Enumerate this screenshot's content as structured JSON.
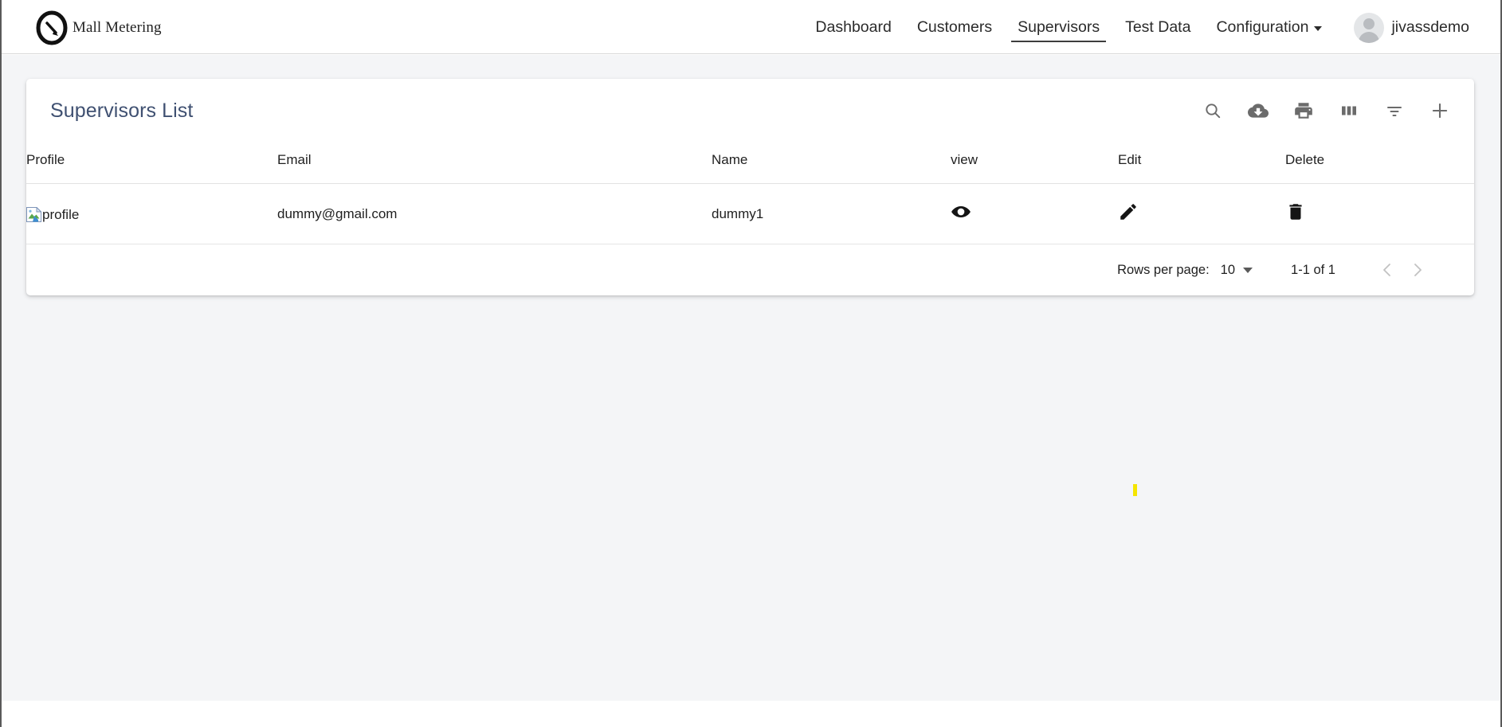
{
  "brand": {
    "name": "Mall Metering",
    "logo_icon": "gauge-meter-icon"
  },
  "nav": {
    "items": [
      {
        "label": "Dashboard",
        "active": false,
        "has_caret": false
      },
      {
        "label": "Customers",
        "active": false,
        "has_caret": false
      },
      {
        "label": "Supervisors",
        "active": true,
        "has_caret": false
      },
      {
        "label": "Test Data",
        "active": false,
        "has_caret": false
      },
      {
        "label": "Configuration",
        "active": false,
        "has_caret": true
      }
    ],
    "user": {
      "name": "jivassdemo",
      "avatar_icon": "user-avatar-icon",
      "caret_icon": "chevron-down-icon"
    }
  },
  "card": {
    "title": "Supervisors List",
    "toolbar": [
      {
        "name": "search-icon",
        "label": "Search"
      },
      {
        "name": "cloud-download-icon",
        "label": "Download"
      },
      {
        "name": "print-icon",
        "label": "Print"
      },
      {
        "name": "view-column-icon",
        "label": "Columns"
      },
      {
        "name": "filter-list-icon",
        "label": "Filter"
      },
      {
        "name": "add-icon",
        "label": "Add"
      }
    ]
  },
  "table": {
    "columns": [
      "Profile",
      "Email",
      "Name",
      "view",
      "Edit",
      "Delete"
    ],
    "rows": [
      {
        "profile_alt": "profile",
        "email": "dummy@gmail.com",
        "name": "dummy1",
        "view_icon": "eye-icon",
        "edit_icon": "pencil-icon",
        "delete_icon": "trash-icon"
      }
    ]
  },
  "paginator": {
    "rows_per_page_label": "Rows per page:",
    "rows_per_page_value": "10",
    "range_label": "1-1 of 1",
    "prev_icon": "chevron-left-icon",
    "next_icon": "chevron-right-icon"
  },
  "colors": {
    "page_background": "#f4f5f7",
    "card_background": "#ffffff",
    "title_color": "#3f5071",
    "toolbar_icon": "#6b6b6b",
    "action_icon": "#151515",
    "marker_yellow": "#f5e500"
  },
  "marker": {
    "name": "yellow-marker"
  }
}
